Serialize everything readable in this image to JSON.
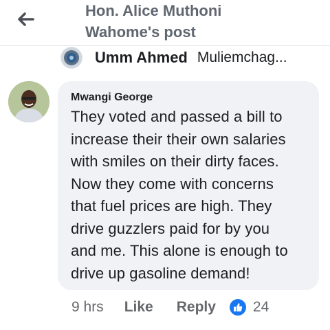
{
  "header": {
    "back_icon": "arrow-left-icon",
    "title_line1": "Hon. Alice Muthoni",
    "title_line2": "Wahome's post"
  },
  "reply_preview": {
    "avatar_icon": "seal-avatar-icon",
    "name": "Umm Ahmed",
    "text": "Muliemchag..."
  },
  "comment": {
    "author": "Mwangi George",
    "lines": [
      "They voted and passed a bill to",
      "increase their their own salaries",
      "with smiles on their dirty faces.",
      "Now they come with concerns",
      "that fuel prices are high. They",
      "drive guzzlers paid for by you",
      "and me. This alone is enough to",
      "drive up gasoline demand!"
    ]
  },
  "actions": {
    "time": "9 hrs",
    "like_label": "Like",
    "reply_label": "Reply",
    "like_icon": "thumbs-up-icon",
    "reaction_count": "24"
  },
  "colors": {
    "bubble": "#f0f2f5",
    "like_badge": "#1877f2",
    "muted_text": "#65676b"
  }
}
